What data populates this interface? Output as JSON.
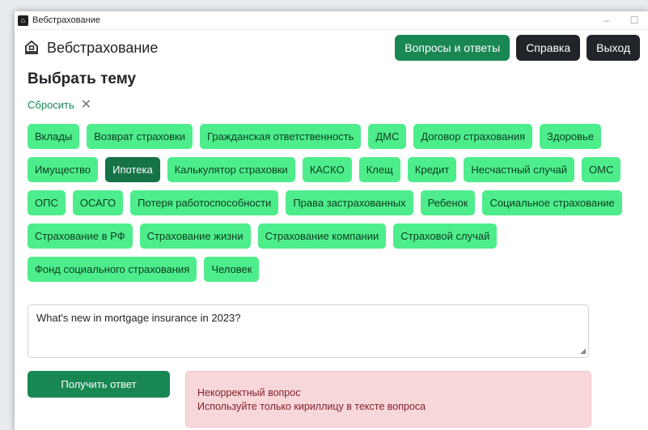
{
  "window": {
    "title": "Вебстрахование"
  },
  "header": {
    "brand": "Вебстрахование",
    "nav": {
      "faq": "Вопросы и ответы",
      "help": "Справка",
      "logout": "Выход"
    }
  },
  "main": {
    "heading": "Выбрать тему",
    "reset_label": "Сбросить",
    "reset_icon": "✕",
    "topics": [
      "Вклады",
      "Возврат страховки",
      "Гражданская ответственность",
      "ДМС",
      "Договор страхования",
      "Здоровье",
      "Имущество",
      "Ипотека",
      "Калькулятор страховки",
      "КАСКО",
      "Клещ",
      "Кредит",
      "Несчастный случай",
      "ОМС",
      "ОПС",
      "ОСАГО",
      "Потеря работоспособности",
      "Права застрахованных",
      "Ребенок",
      "Социальное страхование",
      "Страхование в РФ",
      "Страхование жизни",
      "Страхование компании",
      "Страховой случай",
      "Фонд социального страхования",
      "Человек"
    ],
    "selected_topic": "Ипотека",
    "question_value": "What's new in mortgage insurance in 2023?",
    "submit_label": "Получить ответ",
    "error": {
      "title": "Некорректный вопрос",
      "message": "Используйте только кириллицу в тексте вопроса"
    }
  },
  "colors": {
    "accent": "#198754",
    "tag": "#4eed8c",
    "tag_active": "#157347",
    "dark": "#212529",
    "alert_bg": "#f8d7da"
  }
}
